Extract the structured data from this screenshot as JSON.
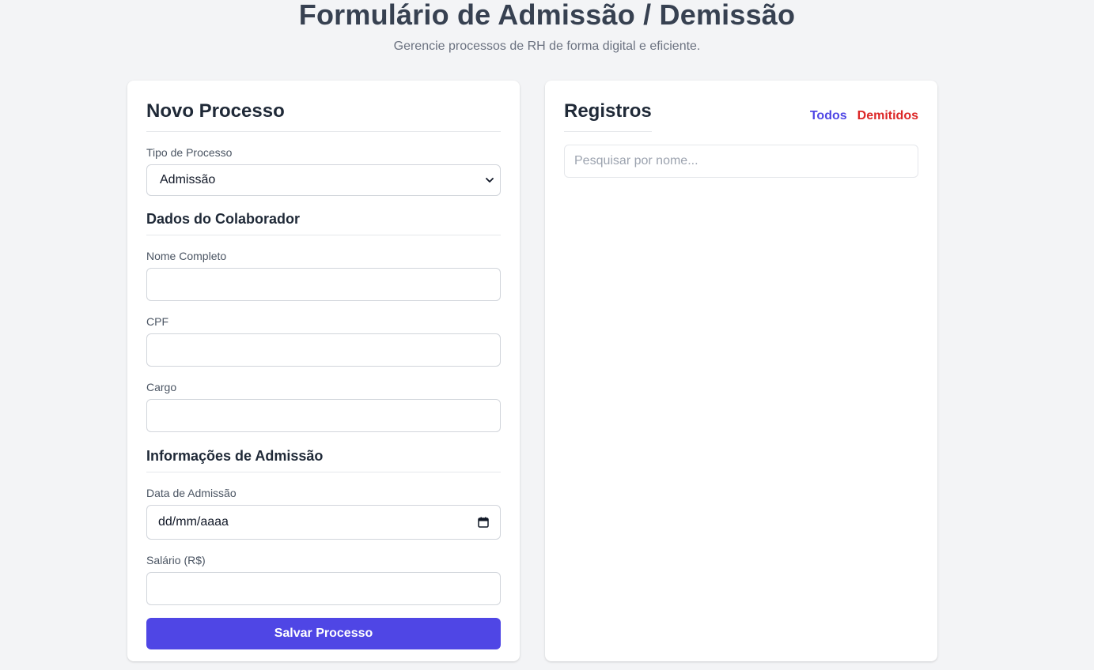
{
  "header": {
    "title": "Formulário de Admissão / Demissão",
    "subtitle": "Gerencie processos de RH de forma digital e eficiente."
  },
  "form": {
    "title": "Novo Processo",
    "process_type_label": "Tipo de Processo",
    "process_type_value": "Admissão",
    "employee_section_title": "Dados do Colaborador",
    "full_name_label": "Nome Completo",
    "full_name_value": "",
    "cpf_label": "CPF",
    "cpf_value": "",
    "role_label": "Cargo",
    "role_value": "",
    "admission_section_title": "Informações de Admissão",
    "admission_date_label": "Data de Admissão",
    "admission_date_placeholder": "dd/mm/aaaa",
    "salary_label": "Salário (R$)",
    "salary_value": "",
    "save_label": "Salvar Processo"
  },
  "records": {
    "title": "Registros",
    "filter_all": "Todos",
    "filter_fired": "Demitidos",
    "search_placeholder": "Pesquisar por nome..."
  },
  "colors": {
    "accent": "#4f46e5",
    "danger": "#dc2626",
    "background": "#f3f4f6"
  },
  "icons": {
    "select_chevron": "chevron-down-icon",
    "date_picker": "calendar-icon"
  }
}
